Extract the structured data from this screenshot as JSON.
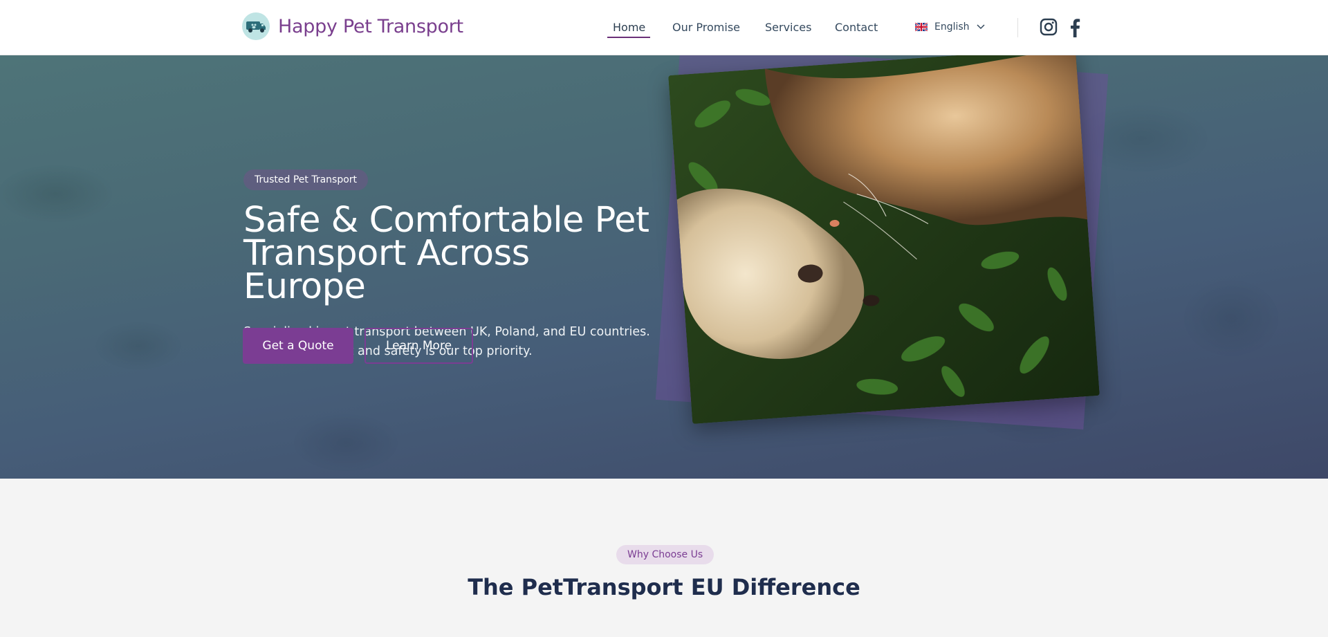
{
  "header": {
    "brand": "Happy Pet Transport",
    "nav": [
      "Home",
      "Our Promise",
      "Services",
      "Contact"
    ],
    "active_nav": "Home",
    "language": "English",
    "social": [
      "instagram-icon",
      "facebook-icon"
    ]
  },
  "hero": {
    "badge": "Trusted Pet Transport",
    "headline_lines": [
      "Safe & Comfortable Pet",
      "Transport Across",
      "Europe"
    ],
    "subtext_lines": [
      "Specialized in pet transport between UK, Poland, and EU countries.",
      "Your pets' comfort and safety is our top priority."
    ],
    "primary_button": "Get a Quote",
    "secondary_button": "Learn More",
    "image_subject": "cat-and-dog-photo"
  },
  "section": {
    "pill": "Why Choose Us",
    "title": "The PetTransport EU Difference"
  },
  "colors": {
    "brand_purple": "#7b3d93",
    "hero_teal": "#4e7478",
    "hero_navy": "#3e4868",
    "title_navy": "#1f2d4d"
  }
}
